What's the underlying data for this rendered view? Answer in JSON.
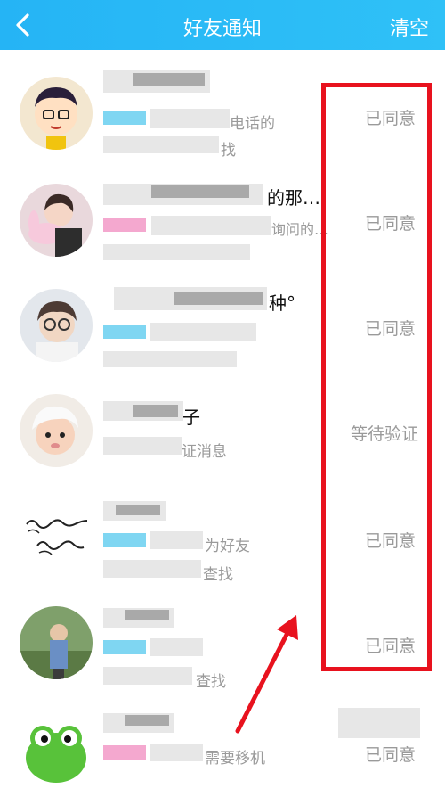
{
  "header": {
    "title": "好友通知",
    "clear_label": "清空"
  },
  "rows": [
    {
      "name_fragment": "",
      "subtitle_fragment": "电话的",
      "subtitle2_fragment": "找",
      "status": "已同意"
    },
    {
      "name_fragment": "的那…",
      "subtitle_fragment": "询问的…",
      "subtitle2_fragment": "",
      "status": "已同意"
    },
    {
      "name_fragment": "种°",
      "subtitle_fragment": "",
      "subtitle2_fragment": "",
      "status": "已同意"
    },
    {
      "name_fragment": "子",
      "subtitle_fragment": "证消息",
      "subtitle2_fragment": "",
      "status": "等待验证"
    },
    {
      "name_fragment": "",
      "subtitle_fragment": "为好友",
      "subtitle2_fragment": "查找",
      "status": "已同意"
    },
    {
      "name_fragment": "",
      "subtitle_fragment": "",
      "subtitle2_fragment": "查找",
      "status": "已同意"
    },
    {
      "name_fragment": "",
      "subtitle_fragment": "需要移机",
      "subtitle2_fragment": "",
      "status": "已同意"
    }
  ],
  "colors": {
    "header": "#2ab8f6",
    "annotation_red": "#e8121e",
    "status_gray": "#9a9a9a"
  }
}
